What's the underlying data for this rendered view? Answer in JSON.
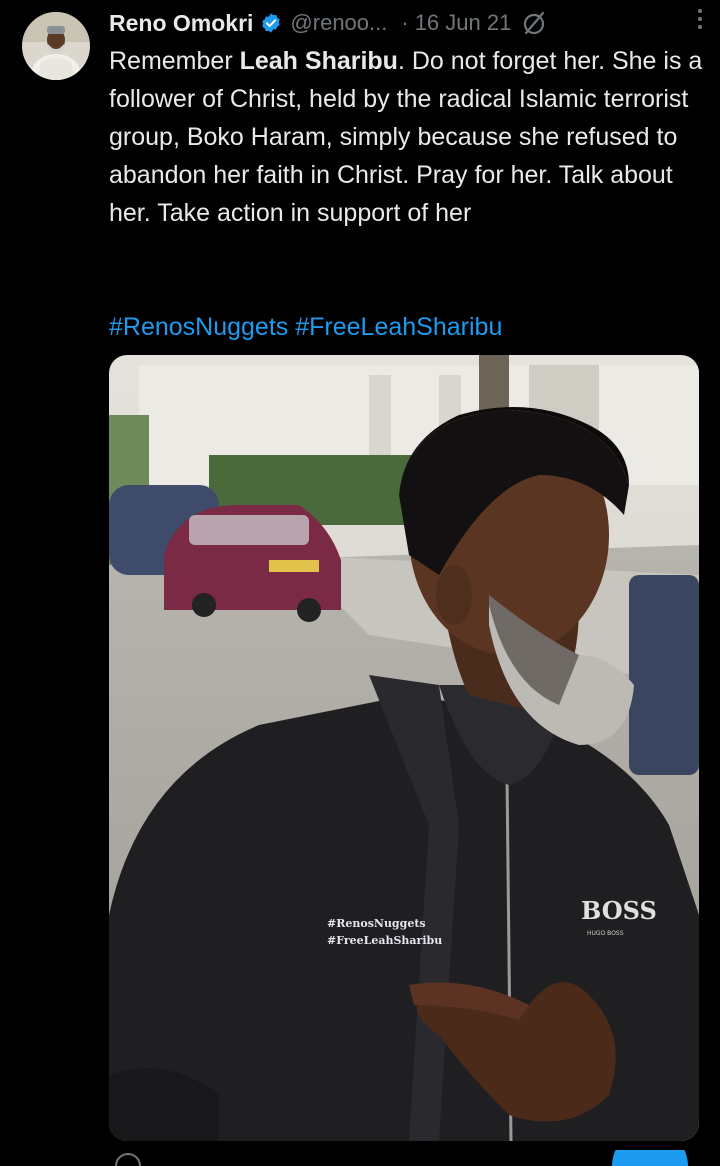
{
  "author": {
    "name": "Reno Omokri",
    "handle": "@renoo...",
    "separator": "·",
    "date": "16 Jun 21"
  },
  "tweet": {
    "intro": "Remember ",
    "bold_name": "Leah Sharibu",
    "body": ". Do not forget her. She is a follower of Christ, held by the radical Islamic terrorist group, Boko Haram, simply because she refused to abandon her faith in Christ. Pray for her. Talk about her. Take action in support of her",
    "hashtags": [
      "#RenosNuggets",
      "#FreeLeahSharibu"
    ]
  },
  "media": {
    "jacket_text_line1": "#RenosNuggets",
    "jacket_text_line2": "#FreeLeahSharibu",
    "brand_line1": "BOSS",
    "brand_line2": "HUGO BOSS"
  },
  "colors": {
    "background": "#000000",
    "text": "#e7e9ea",
    "muted": "#71767b",
    "link": "#1d9bf0",
    "verified": "#1d9bf0"
  },
  "icons": {
    "verified": "verified-badge-icon",
    "grok": "grok-icon",
    "more": "more-options-icon"
  }
}
